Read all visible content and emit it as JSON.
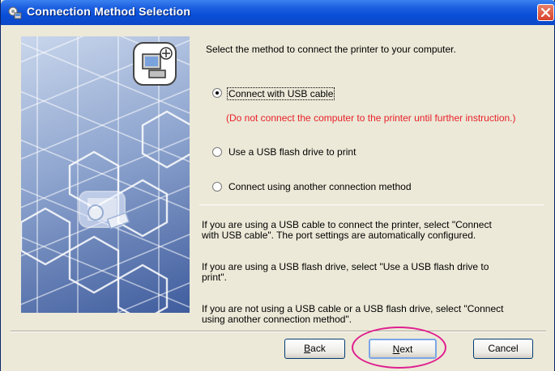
{
  "window": {
    "title": "Connection Method Selection",
    "title_icon": "setup-icon",
    "close_icon": "close-icon"
  },
  "main": {
    "intro": "Select the method to connect the printer to your computer.",
    "options": [
      {
        "label": "Connect with USB cable",
        "checked": true
      },
      {
        "label": "Use a USB flash drive to print",
        "checked": false
      },
      {
        "label": "Connect using another connection method",
        "checked": false
      }
    ],
    "warning": "(Do not connect the computer to the printer until further instruction.)",
    "help": [
      {
        "line1": "If you are using a USB cable to connect the printer, select \"Connect",
        "line2": "with USB cable\". The port settings are automatically configured."
      },
      {
        "line1": "If you are using a USB flash drive, select \"Use a USB flash drive to",
        "line2": "print\"."
      },
      {
        "line1": "If you are not using a USB cable or a USB flash drive, select \"Connect",
        "line2": "using another connection method\"."
      }
    ]
  },
  "buttons": {
    "back": {
      "prefix": "",
      "mnemonic": "B",
      "rest": "ack"
    },
    "next": {
      "prefix": "",
      "mnemonic": "N",
      "rest": "ext"
    },
    "cancel": "Cancel"
  },
  "colors": {
    "accent": "#0a4fd8",
    "warning": "#e8202a",
    "highlight": "#e0208f"
  }
}
